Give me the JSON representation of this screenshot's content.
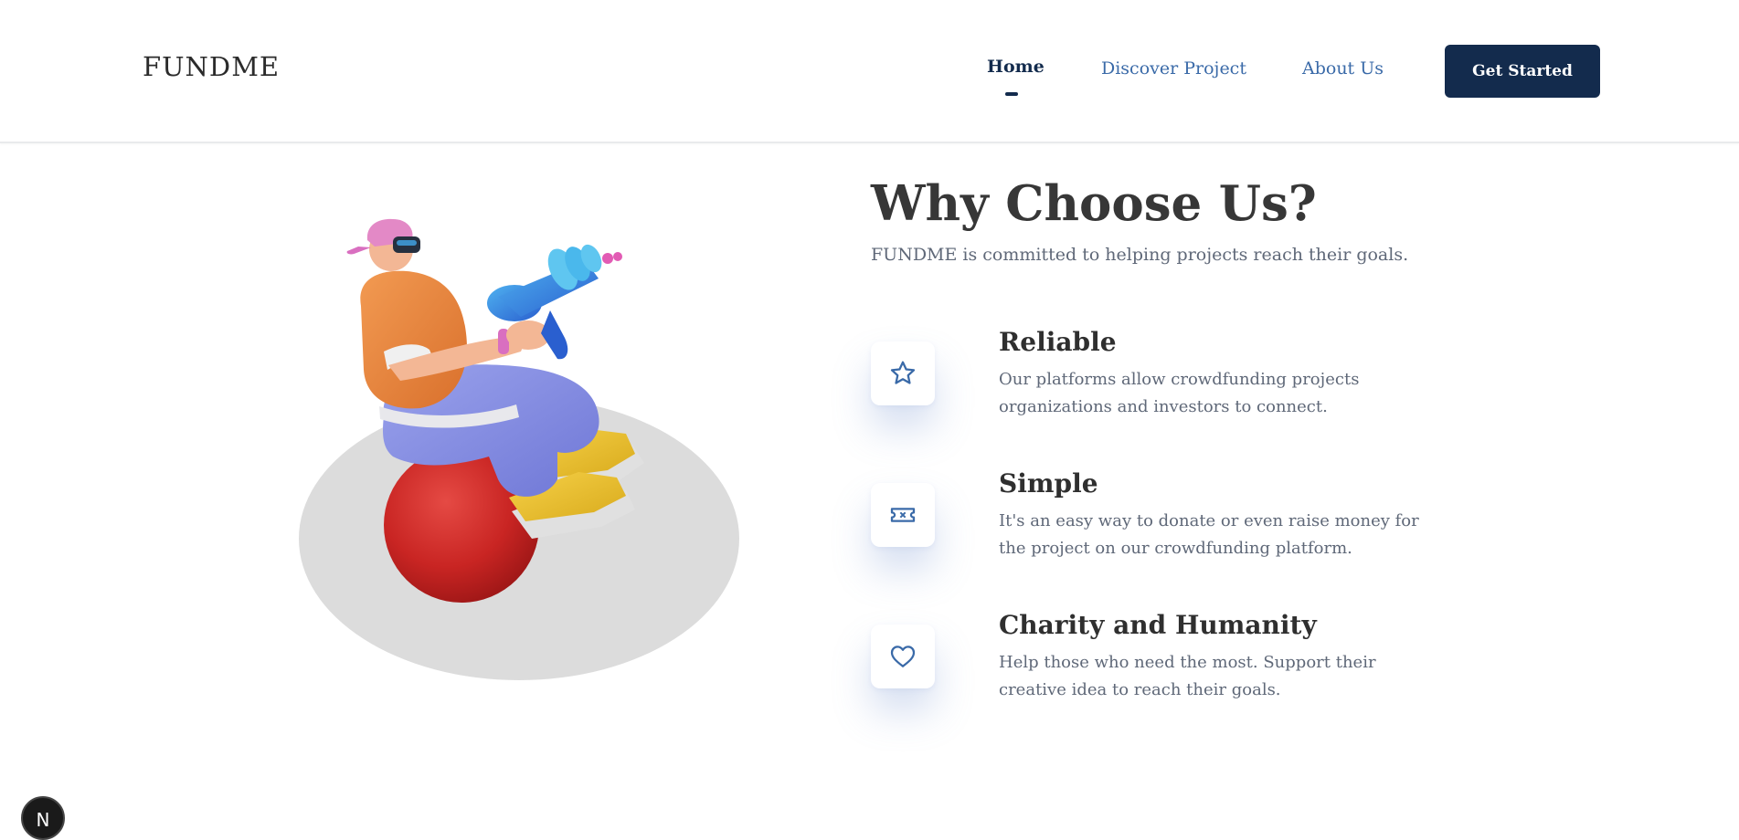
{
  "header": {
    "logo": "FUNDME",
    "nav": [
      {
        "label": "Home",
        "active": true
      },
      {
        "label": "Discover Project",
        "active": false
      },
      {
        "label": "About Us",
        "active": false
      }
    ],
    "cta_label": "Get Started"
  },
  "section": {
    "title": "Why Choose Us?",
    "subtitle": "FUNDME is committed to helping projects reach their goals.",
    "features": [
      {
        "icon": "star-icon",
        "title": "Reliable",
        "description": "Our platforms allow crowdfunding projects organizations and investors to connect."
      },
      {
        "icon": "ticket-icon",
        "title": "Simple",
        "description": "It's an easy way to donate or even raise money for the project on our crowdfunding platform."
      },
      {
        "icon": "heart-icon",
        "title": "Charity and Humanity",
        "description": "Help those who need the most. Support their creative idea to reach their goals."
      }
    ]
  },
  "badge": {
    "label": "N"
  },
  "colors": {
    "primary": "#132b4d",
    "link": "#3a6aa8",
    "heading": "#373737",
    "body_text": "#5f6878",
    "icon_stroke": "#3a6aa8"
  }
}
